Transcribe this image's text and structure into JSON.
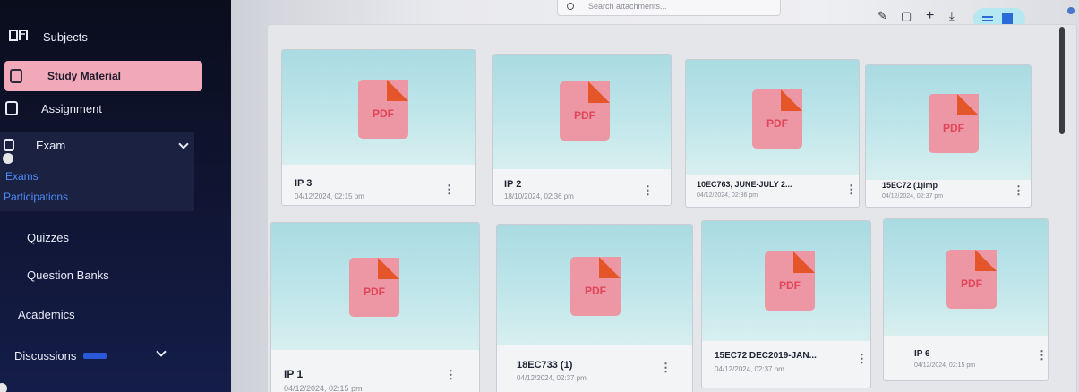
{
  "sidebar": {
    "items": [
      {
        "label": "Subjects",
        "icon": "book-icon"
      },
      {
        "label": "Study Material",
        "icon": "document-icon"
      },
      {
        "label": "Assignment",
        "icon": "clipboard-icon"
      },
      {
        "label": "Exam",
        "icon": "exam-icon"
      },
      {
        "label": "Quizzes"
      },
      {
        "label": "Question Banks"
      },
      {
        "label": "Academics"
      },
      {
        "label": "Discussions",
        "icon": "chevron-down-icon"
      }
    ],
    "exam_sub": [
      "Exams",
      "Participations"
    ]
  },
  "search": {
    "placeholder": "Search attachments..."
  },
  "toolbar": {
    "icons": [
      "pencil-icon",
      "copy-icon",
      "plus-icon",
      "download-icon",
      "list-view-icon",
      "grid-view-icon"
    ],
    "accent": "#2b6bd8"
  },
  "files": [
    {
      "title": "IP 3",
      "date": "04/12/2024, 02:15 pm"
    },
    {
      "title": "IP 2",
      "date": "18/10/2024, 02:36 pm"
    },
    {
      "title": "10EC763, JUNE-JULY 2...",
      "date": "04/12/2024, 02:36 pm"
    },
    {
      "title": "15EC72 (1)imp",
      "date": "04/12/2024, 02:37 pm"
    },
    {
      "title": "IP 1",
      "date": "04/12/2024, 02:15 pm"
    },
    {
      "title": "18EC733 (1)",
      "date": "04/12/2024, 02:37 pm"
    },
    {
      "title": "15EC72 DEC2019-JAN...",
      "date": "04/12/2024, 02:37 pm"
    },
    {
      "title": "IP 6",
      "date": "04/12/2024, 02:15 pm"
    }
  ],
  "pdf_label": "PDF",
  "colors": {
    "active_nav": "#f1a9b9",
    "link": "#4f8dff",
    "pdf_icon": "#ec97a3",
    "pdf_fold": "#e5552a"
  }
}
